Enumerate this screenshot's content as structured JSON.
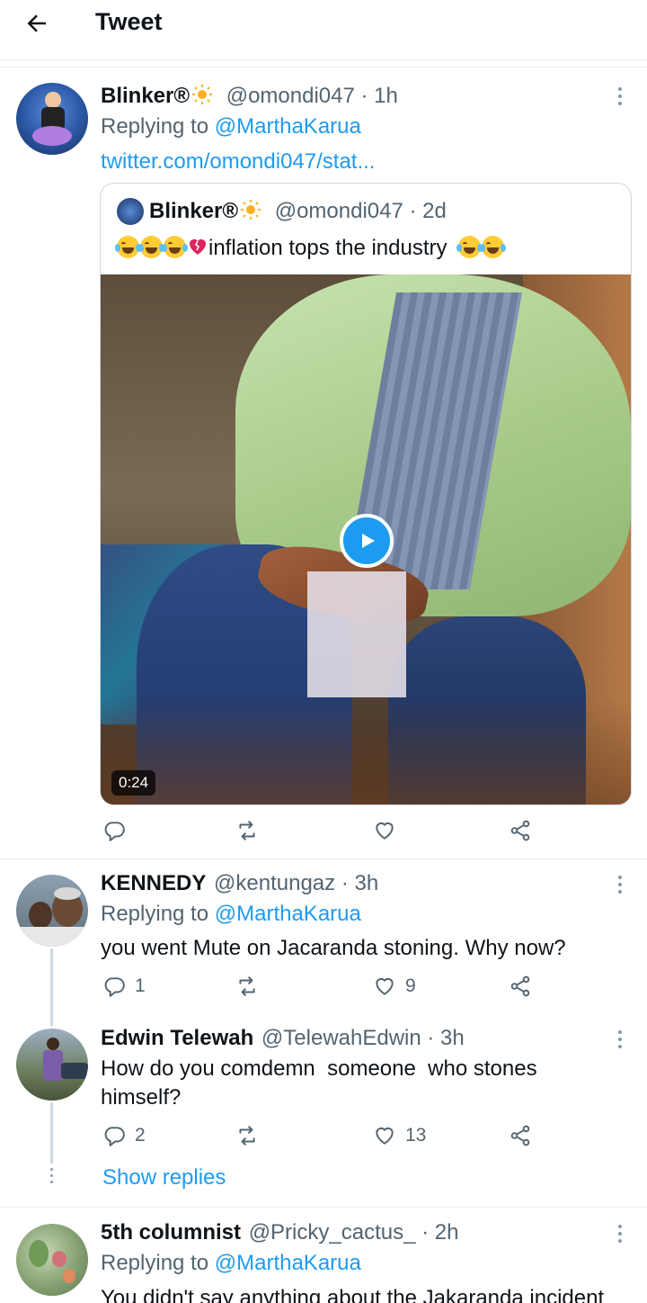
{
  "header": {
    "title": "Tweet"
  },
  "tweets": [
    {
      "name": "Blinker®",
      "handle": "@omondi047",
      "time": "· 1h",
      "replying_prefix": "Replying to",
      "replying_to": "@MarthaKarua",
      "link": "twitter.com/omondi047/stat...",
      "quoted": {
        "name": "Blinker®",
        "handle": "@omondi047",
        "time": "· 2d",
        "text": "inflation tops the industry",
        "video_duration": "0:24"
      }
    },
    {
      "name": "KENNEDY",
      "handle": "@kentungaz",
      "time": "· 3h",
      "replying_prefix": "Replying to",
      "replying_to": "@MarthaKarua",
      "text": "you went Mute on Jacaranda stoning. Why now?",
      "replies": "1",
      "likes": "9"
    },
    {
      "name": "Edwin Telewah",
      "handle": "@TelewahEdwin",
      "time": "· 3h",
      "text_line1": "How do you comdemn  someone  who stones",
      "text_line2": "himself?",
      "replies": "2",
      "likes": "13"
    },
    {
      "name": "5th columnist",
      "handle": "@Pricky_cactus_",
      "time": "· 2h",
      "replying_prefix": "Replying to",
      "replying_to": "@MarthaKarua",
      "text_partial": "You didn't say anything about the Jakaranda incident"
    }
  ],
  "show_replies": "Show replies",
  "icons": {
    "back": "back-arrow-icon",
    "more": "more-vertical-icon",
    "reply": "reply-icon",
    "retweet": "retweet-icon",
    "like": "like-icon",
    "share": "share-icon",
    "play": "play-icon"
  },
  "colors": {
    "accent": "#1d9bf0",
    "text": "#0f1419",
    "secondary": "#536471",
    "divider": "#e6ecf0"
  }
}
